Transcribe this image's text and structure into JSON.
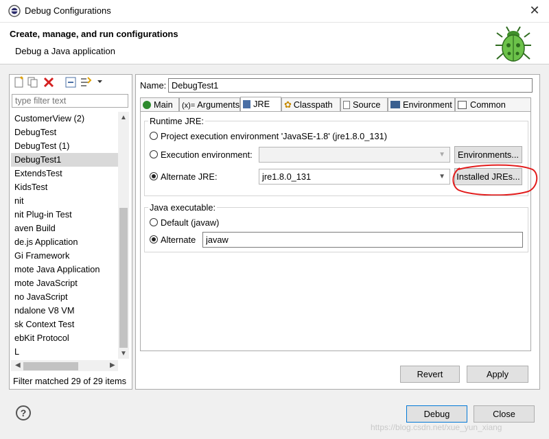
{
  "window": {
    "title": "Debug Configurations",
    "close_glyph": "✕"
  },
  "header": {
    "title": "Create, manage, and run configurations",
    "description": "Debug a Java application",
    "icon": "bug-icon"
  },
  "left_panel": {
    "toolbar_icons": [
      "new-config-icon",
      "duplicate-icon",
      "delete-icon",
      "collapse-all-icon",
      "filter-icon",
      "dropdown-arrow-icon"
    ],
    "filter_placeholder": "type filter text",
    "items": [
      {
        "label": "CustomerView (2)",
        "selected": false
      },
      {
        "label": "DebugTest",
        "selected": false
      },
      {
        "label": "DebugTest (1)",
        "selected": false
      },
      {
        "label": "DebugTest1",
        "selected": true
      },
      {
        "label": "ExtendsTest",
        "selected": false
      },
      {
        "label": "KidsTest",
        "selected": false
      },
      {
        "label": "nit",
        "selected": false
      },
      {
        "label": "nit Plug-in Test",
        "selected": false
      },
      {
        "label": "aven Build",
        "selected": false
      },
      {
        "label": "de.js Application",
        "selected": false
      },
      {
        "label": "Gi Framework",
        "selected": false
      },
      {
        "label": "mote Java Application",
        "selected": false
      },
      {
        "label": "mote JavaScript",
        "selected": false
      },
      {
        "label": "no JavaScript",
        "selected": false
      },
      {
        "label": "ndalone V8 VM",
        "selected": false
      },
      {
        "label": "sk Context Test",
        "selected": false
      },
      {
        "label": "ebKit Protocol",
        "selected": false
      },
      {
        "label": "L",
        "selected": false
      }
    ],
    "filter_status": "Filter matched 29 of 29 items"
  },
  "config": {
    "name_label": "Name:",
    "name_value": "DebugTest1",
    "tabs": [
      {
        "label": "Main",
        "icon": "main-icon",
        "active": false
      },
      {
        "label": "Arguments",
        "icon": "arguments-icon",
        "active": false
      },
      {
        "label": "JRE",
        "icon": "jre-icon",
        "active": true
      },
      {
        "label": "Classpath",
        "icon": "classpath-icon",
        "active": false
      },
      {
        "label": "Source",
        "icon": "source-icon",
        "active": false
      },
      {
        "label": "Environment",
        "icon": "environment-icon",
        "active": false
      },
      {
        "label": "Common",
        "icon": "common-icon",
        "active": false
      }
    ],
    "runtime_jre": {
      "group_label": "Runtime JRE:",
      "project_option": "Project execution environment 'JavaSE-1.8' (jre1.8.0_131)",
      "exec_env_option": "Execution environment:",
      "exec_env_value": "",
      "environments_button": "Environments...",
      "alternate_option": "Alternate JRE:",
      "alternate_value": "jre1.8.0_131",
      "installed_button": "Installed JREs...",
      "selected": "alternate"
    },
    "java_executable": {
      "group_label": "Java executable:",
      "default_option": "Default (javaw)",
      "alternate_option": "Alternate",
      "alternate_value": "javaw",
      "selected": "alternate"
    },
    "revert_button": "Revert",
    "apply_button": "Apply"
  },
  "footer": {
    "help_glyph": "?",
    "debug_button": "Debug",
    "close_button": "Close",
    "watermark": "https://blog.csdn.net/xue_yun_xiang"
  },
  "colors": {
    "annotation": "#e21b1b",
    "selection": "#d9d9d9",
    "accent": "#0078d7"
  }
}
